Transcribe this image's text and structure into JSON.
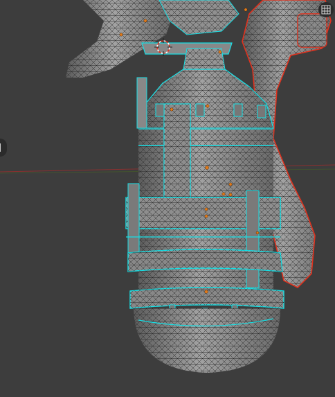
{
  "viewport": {
    "background": "#3d3d3d",
    "mesh_fill": "#7f7f7f",
    "wire_color": "#2a2a2a",
    "seam_color": "#16e0e6",
    "selection_color": "#e0321e",
    "vertex_color": "#e07a1a",
    "axis_x_color": "#8a3030",
    "axis_y_color": "#4a6a20"
  },
  "overlay": {
    "mesh_icon": "wireframe-grid-icon",
    "side_tab_icon": "sidebar-tab-icon"
  }
}
